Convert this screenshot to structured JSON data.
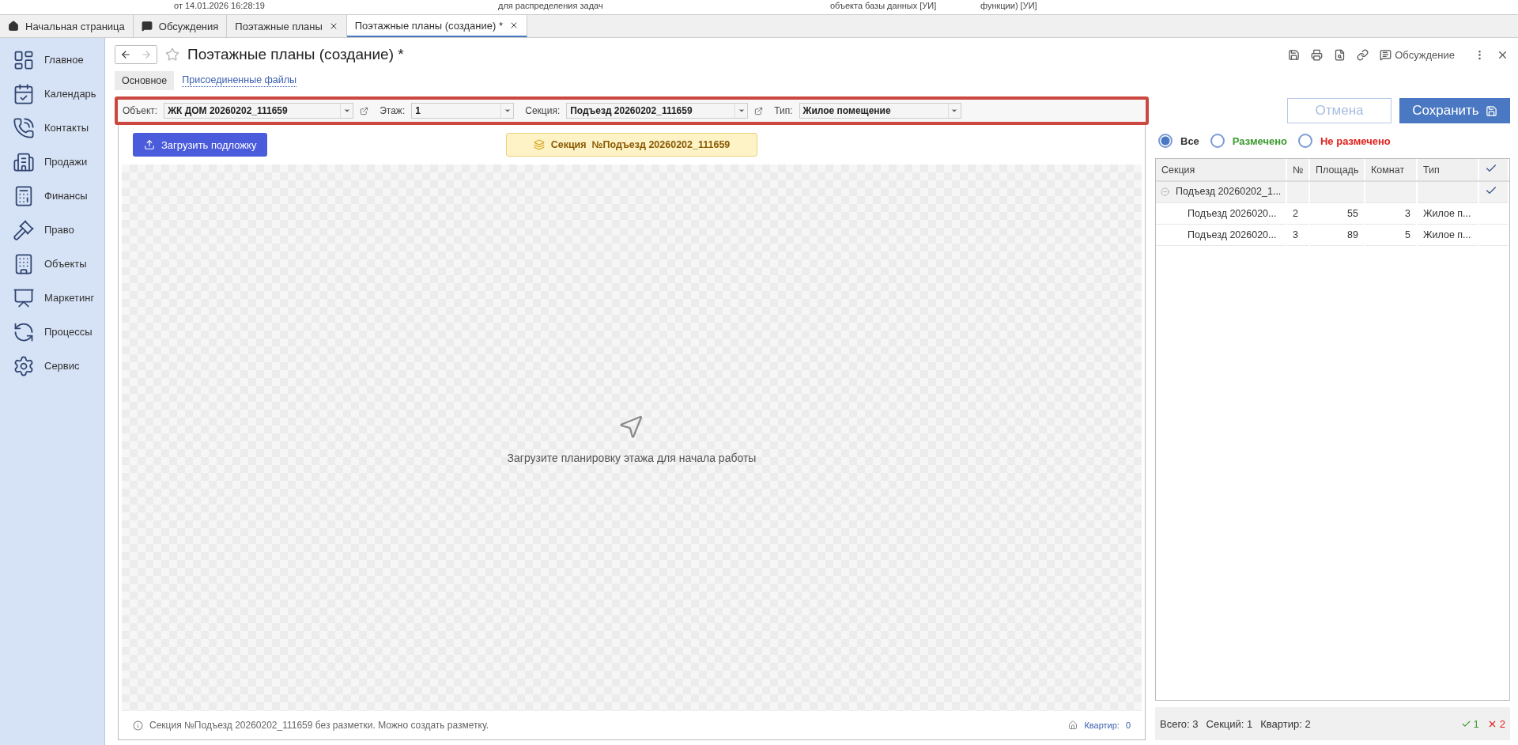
{
  "top_strip": [
    "от 14.01.2026 16:28:19",
    "для распределения задач",
    "объекта базы данных [УИ]",
    "функции) [УИ]"
  ],
  "tabs": [
    {
      "kind": "home",
      "label": "Начальная страница",
      "selected": false,
      "closable": false
    },
    {
      "kind": "chat",
      "label": "Обсуждения",
      "selected": false,
      "closable": false
    },
    {
      "kind": "plain",
      "label": "Поэтажные планы",
      "selected": false,
      "closable": true
    },
    {
      "kind": "plain",
      "label": "Поэтажные планы (создание) *",
      "selected": true,
      "closable": true
    }
  ],
  "sidebar": {
    "items": [
      {
        "label": "Главное"
      },
      {
        "label": "Календарь"
      },
      {
        "label": "Контакты"
      },
      {
        "label": "Продажи"
      },
      {
        "label": "Финансы"
      },
      {
        "label": "Право"
      },
      {
        "label": "Объекты"
      },
      {
        "label": "Маркетинг"
      },
      {
        "label": "Процессы"
      },
      {
        "label": "Сервис"
      }
    ]
  },
  "form": {
    "title": "Поэтажные планы (создание) *",
    "discussion": "Обсуждение",
    "subtabs": [
      {
        "label": "Основное",
        "selected": true
      },
      {
        "label": "Присоединенные файлы",
        "selected": false
      }
    ]
  },
  "filters": [
    {
      "label": "Объект:",
      "value": "ЖК ДОМ 20260202_111659",
      "open_button": true
    },
    {
      "label": "Этаж:",
      "value": "1",
      "open_button": false
    },
    {
      "label": "Секция:",
      "value": "Подъезд 20260202_111659",
      "open_button": true
    },
    {
      "label": "Тип:",
      "value": "Жилое помещение",
      "open_button": false
    }
  ],
  "canvas": {
    "upload_button": "Загрузить подложку",
    "section_badge": "Секция  №Подъезд 20260202_111659",
    "hint": "Загрузите планировку этажа для начала работы",
    "status": "Секция №Подъезд 20260202_111659 без разметки. Можно создать разметку.",
    "apartments_label": "Квартир:",
    "apartments_count": "0"
  },
  "actions": {
    "cancel": "Отмена",
    "save": "Сохранить"
  },
  "radio_filter": [
    {
      "label": "Все",
      "selected": true,
      "color": "#333333"
    },
    {
      "label": "Размечено",
      "selected": false,
      "color": "#3c9a2e"
    },
    {
      "label": "Не размечено",
      "selected": false,
      "color": "#e0201b"
    }
  ],
  "table": {
    "columns": [
      "Секция",
      "№",
      "Площадь",
      "Комнат",
      "Тип"
    ],
    "rows": [
      {
        "cells": [
          "Подъезд 20260202_1...",
          "",
          "",
          "",
          ""
        ],
        "checked": true,
        "expanded": true,
        "children": [
          {
            "cells": [
              "Подъезд 2026020...",
              "2",
              "55",
              "3",
              "Жилое п..."
            ],
            "checked": false
          },
          {
            "cells": [
              "Подъезд 2026020...",
              "3",
              "89",
              "5",
              "Жилое п..."
            ],
            "checked": false
          }
        ]
      }
    ]
  },
  "summary": {
    "total": "Всего: 3",
    "sections": "Секций: 1",
    "apartments": "Квартир: 2",
    "marked": "1",
    "unmarked": "2"
  }
}
